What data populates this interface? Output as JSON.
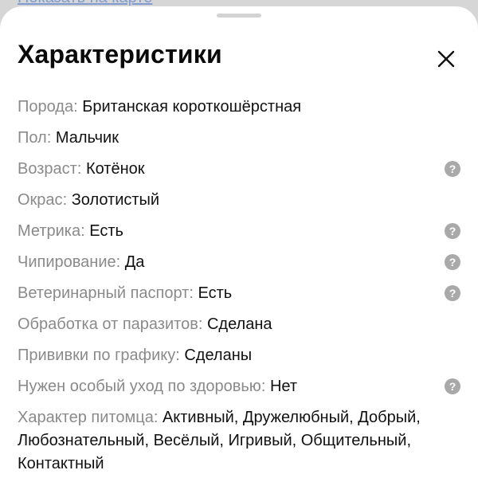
{
  "backdrop": {
    "link_label": "Показать на карте"
  },
  "sheet": {
    "title": "Характеристики",
    "close_icon": "close-icon",
    "help_icon": "question-circle-icon",
    "rows": [
      {
        "key": "Порода",
        "value": "Британская короткошёрстная",
        "has_help": false
      },
      {
        "key": "Пол",
        "value": "Мальчик",
        "has_help": false
      },
      {
        "key": "Возраст",
        "value": "Котёнок",
        "has_help": true
      },
      {
        "key": "Окрас",
        "value": "Золотистый",
        "has_help": false
      },
      {
        "key": "Метрика",
        "value": "Есть",
        "has_help": true
      },
      {
        "key": "Чипирование",
        "value": "Да",
        "has_help": true
      },
      {
        "key": "Ветеринарный паспорт",
        "value": "Есть",
        "has_help": true
      },
      {
        "key": "Обработка от паразитов",
        "value": "Сделана",
        "has_help": false
      },
      {
        "key": "Прививки по графику",
        "value": "Сделаны",
        "has_help": false
      },
      {
        "key": "Нужен особый уход по здоровью",
        "value": "Нет",
        "has_help": true
      },
      {
        "key": "Характер питомца",
        "value": "Активный, Дружелюбный, Добрый, Любознательный, Весёлый, Игривый, Общительный, Контактный",
        "has_help": false
      }
    ]
  },
  "colors": {
    "key_text": "#8a8a8a",
    "value_text": "#111111",
    "help_badge": "#a9a9a9"
  }
}
